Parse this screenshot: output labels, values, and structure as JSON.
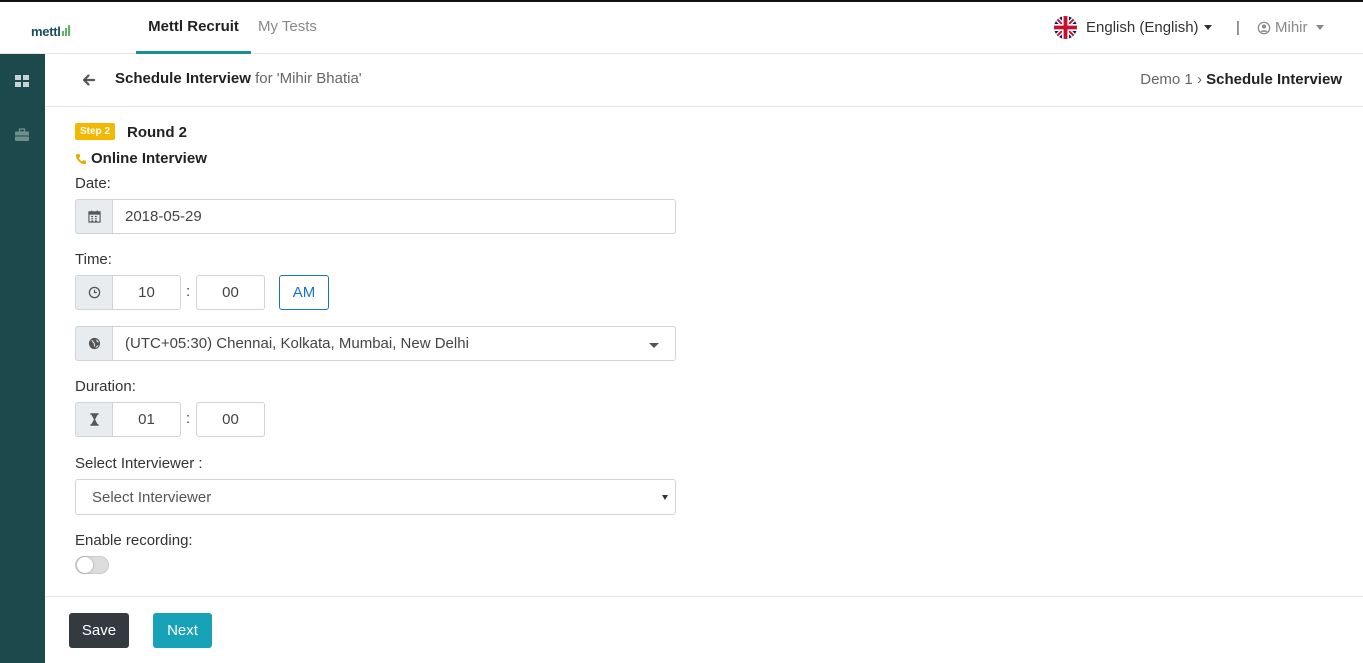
{
  "header": {
    "logo_text": "mettl",
    "tabs": [
      {
        "label": "Mettl Recruit",
        "active": true
      },
      {
        "label": "My Tests",
        "active": false
      }
    ],
    "language": "English (English)",
    "separator": "|",
    "user_name": "Mihir"
  },
  "sidebar": {
    "items": [
      {
        "icon": "dashboard-grid-icon"
      },
      {
        "icon": "briefcase-icon"
      }
    ]
  },
  "subheader": {
    "title": "Schedule Interview",
    "title_suffix": "for 'Mihir Bhatia'",
    "breadcrumb": {
      "parent": "Demo 1",
      "separator": "›",
      "current": "Schedule Interview"
    }
  },
  "form": {
    "step_badge": "Step 2",
    "round": "Round 2",
    "mode": "Online Interview",
    "date_label": "Date:",
    "date_value": "2018-05-29",
    "time_label": "Time:",
    "time_hour": "10",
    "time_minute": "00",
    "time_colon": ":",
    "ampm": "AM",
    "timezone": "(UTC+05:30) Chennai, Kolkata, Mumbai, New Delhi",
    "duration_label": "Duration:",
    "duration_hours": "01",
    "duration_minutes": "00",
    "interviewer_label": "Select Interviewer :",
    "interviewer_placeholder": "Select Interviewer",
    "recording_label": "Enable recording:",
    "recording_enabled": false
  },
  "footer": {
    "save_label": "Save",
    "next_label": "Next"
  },
  "colors": {
    "sidebar": "#1c4a4c",
    "active_tab_underline": "#1a8f9a",
    "step_badge": "#f5b800",
    "ampm_border": "#1a73c9",
    "save_button": "#343a40",
    "next_button": "#17a2b8"
  }
}
